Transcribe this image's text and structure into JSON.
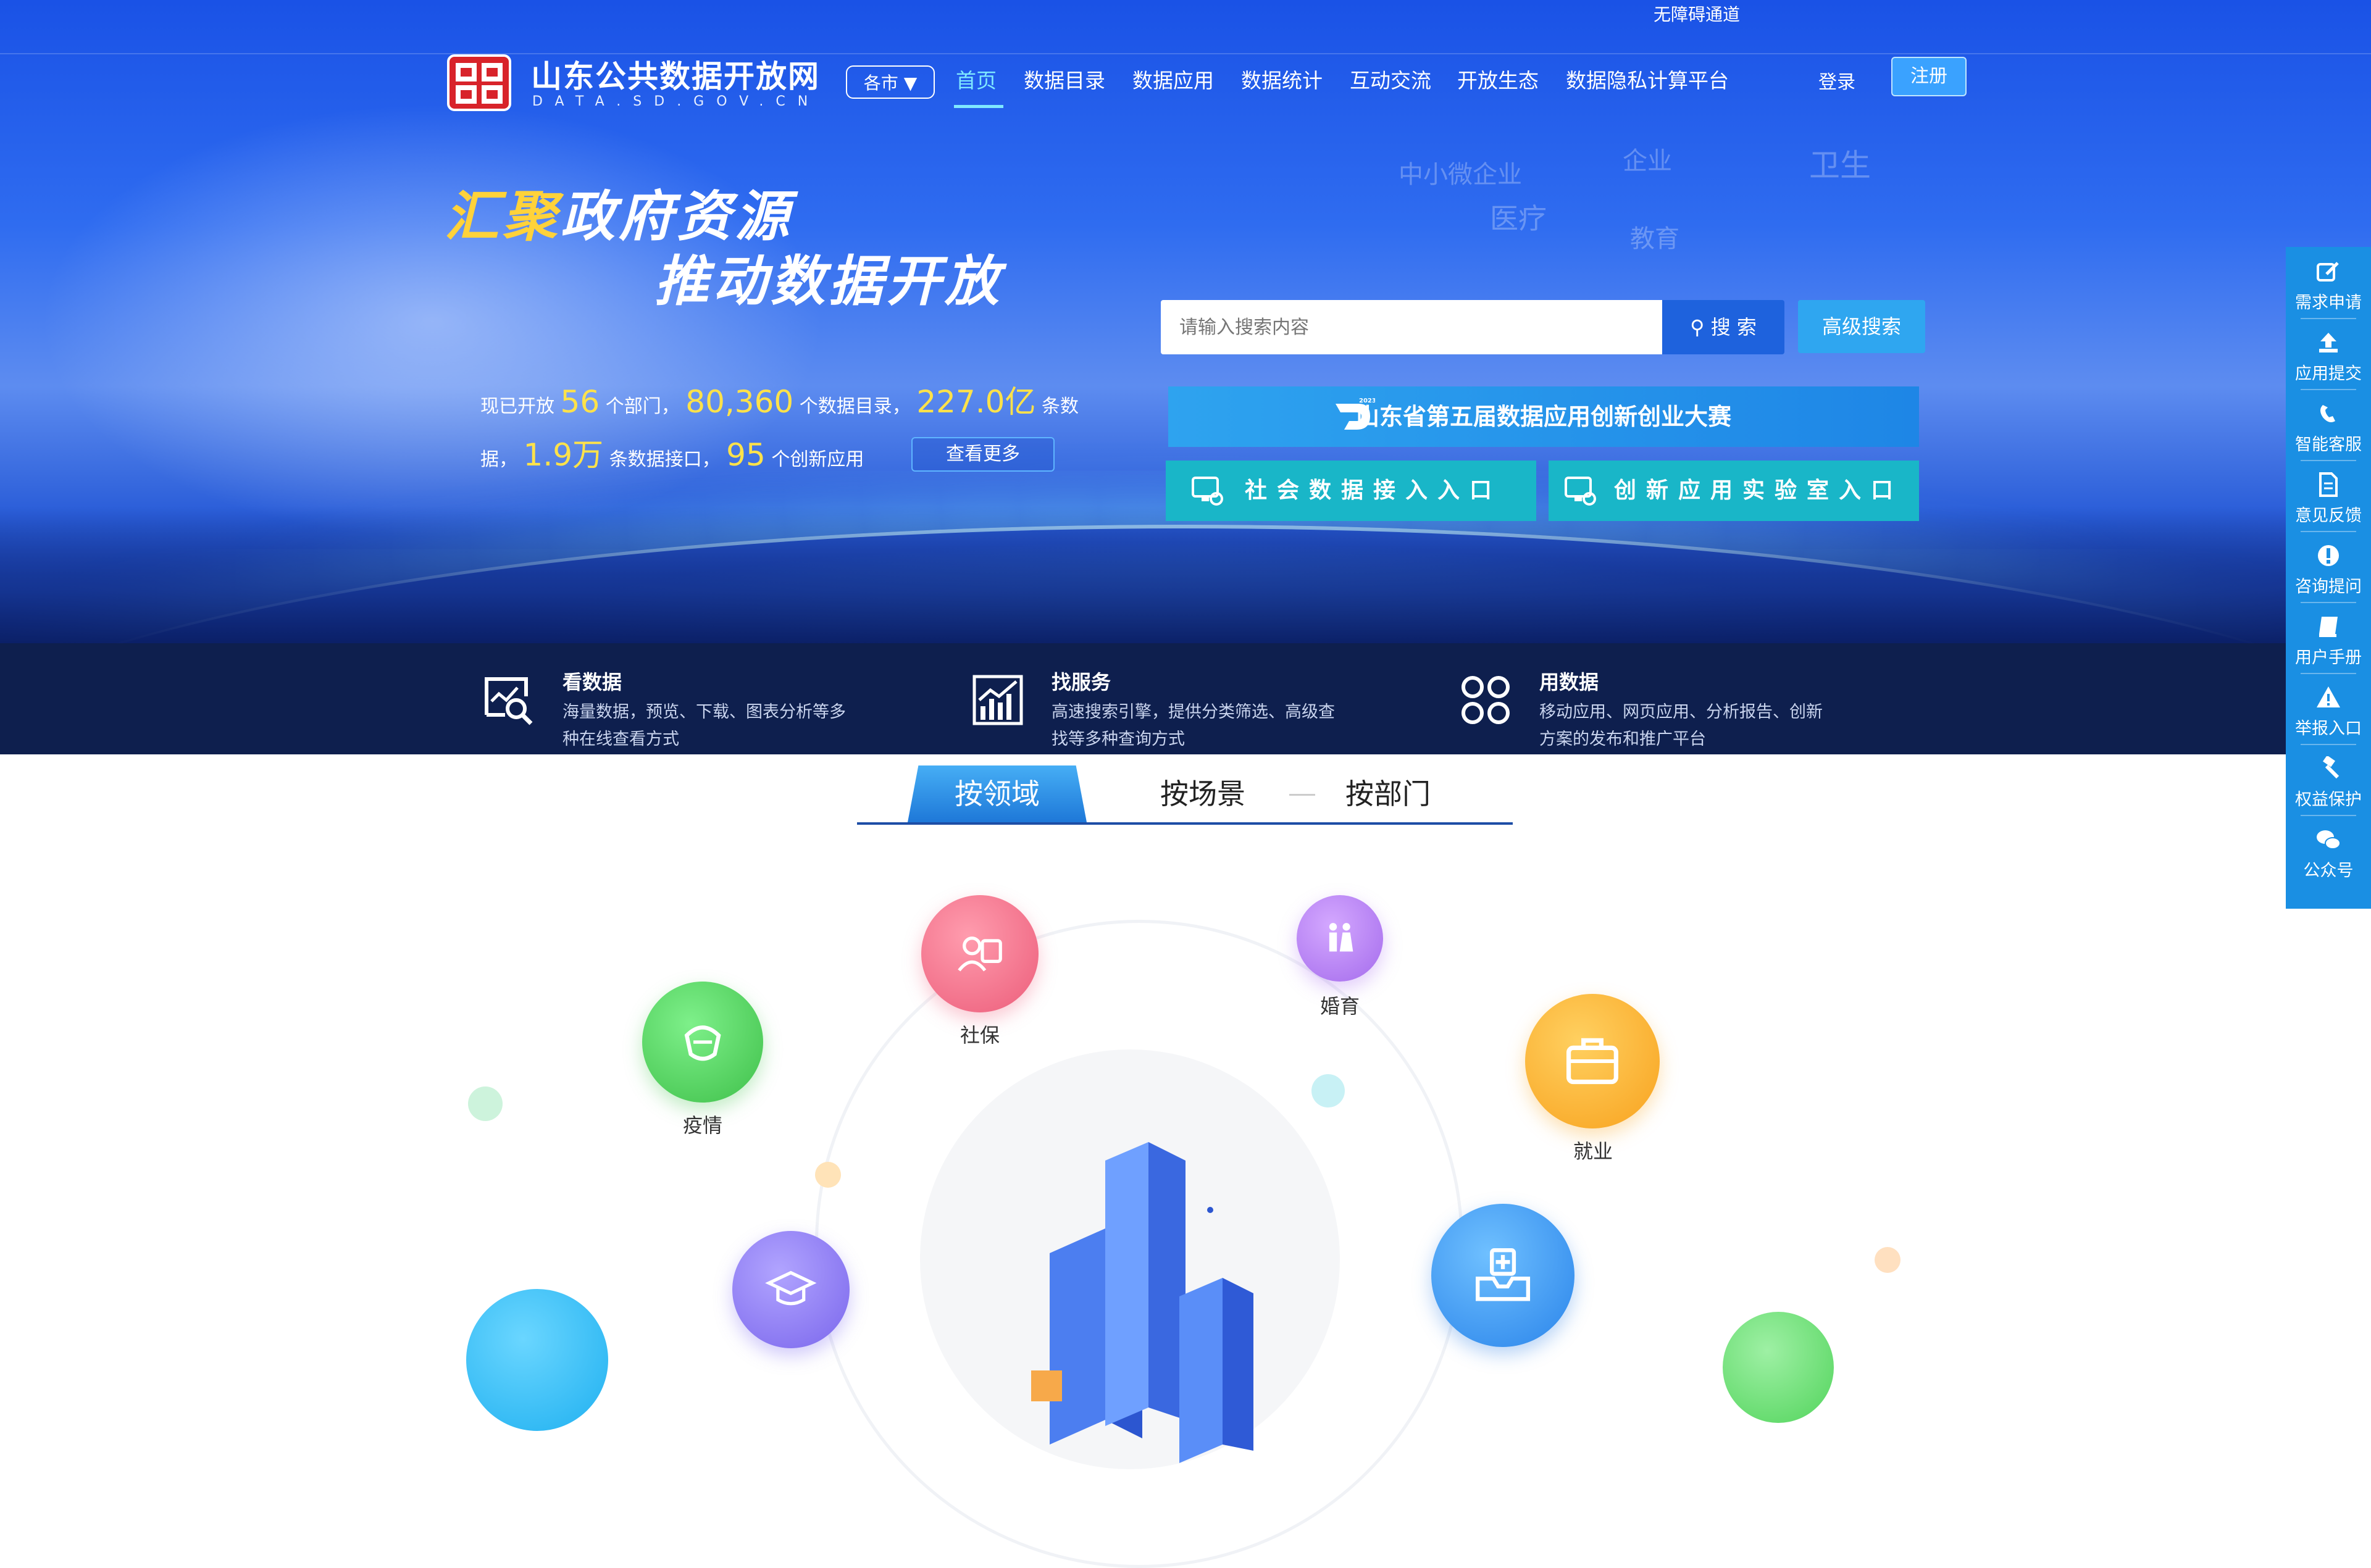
{
  "header": {
    "accessibility_link": "无障碍通道",
    "site_title": "山东公共数据开放网",
    "site_domain": "DATA.SD.GOV.CN",
    "city_select": "各市",
    "nav": [
      "首页",
      "数据目录",
      "数据应用",
      "数据统计",
      "互动交流",
      "开放生态",
      "数据隐私计算平台"
    ],
    "active_nav": "首页",
    "login": "登录",
    "register": "注册"
  },
  "hero": {
    "slogan_line1_highlight": "汇聚",
    "slogan_line1_rest": "政府资源",
    "slogan_line2": "推动数据开放",
    "map_words": [
      "中小微企业",
      "企业",
      "卫生",
      "医疗",
      "教育"
    ],
    "stats": {
      "prefix": "现已开放",
      "departments_value": "56",
      "departments_unit": "个部门，",
      "catalogs_value": "80,360",
      "catalogs_unit": "个数据目录，",
      "records_value": "227.0亿",
      "records_unit_a": "条数",
      "records_unit_b": "据，",
      "apis_value": "1.9万",
      "apis_unit": "条数据接口，",
      "apps_value": "95",
      "apps_unit": "个创新应用"
    },
    "more_button": "查看更多",
    "search": {
      "placeholder": "请输入搜索内容",
      "button": "搜 索",
      "advanced": "高级搜索"
    },
    "contest_badge_year": "2023",
    "contest_banner": "山东省第五届数据应用创新创业大赛",
    "social_data_entry": "社会数据接入入口",
    "innovation_lab_entry": "创新应用实验室入口"
  },
  "features": [
    {
      "title": "看数据",
      "desc": "海量数据，预览、下载、图表分析等多种在线查看方式",
      "icon": "magnifier-chart-icon"
    },
    {
      "title": "找服务",
      "desc": "高速搜索引擎，提供分类筛选、高级查找等多种查询方式",
      "icon": "bar-chart-icon"
    },
    {
      "title": "用数据",
      "desc": "移动应用、网页应用、分析报告、创新方案的发布和推广平台",
      "icon": "four-squares-icon"
    }
  ],
  "tabs": [
    "按领域",
    "按场景",
    "按部门"
  ],
  "active_tab": "按领域",
  "domains": [
    {
      "label": "疫情",
      "color": "#4fd05a",
      "icon": "mask-icon"
    },
    {
      "label": "社保",
      "color": "#f06c86",
      "icon": "social-security-icon"
    },
    {
      "label": "婚育",
      "color": "#b27ef0",
      "icon": "family-icon"
    },
    {
      "label": "就业",
      "color": "#fbb428",
      "icon": "briefcase-icon"
    },
    {
      "label": "",
      "color": "#8a7ef0",
      "icon": "graduation-cap-icon"
    },
    {
      "label": "",
      "color": "#3aa0f0",
      "icon": "medical-kit-icon"
    }
  ],
  "right_rail": [
    {
      "label": "需求申请",
      "icon": "edit-icon"
    },
    {
      "label": "应用提交",
      "icon": "upload-icon"
    },
    {
      "label": "智能客服",
      "icon": "phone-icon"
    },
    {
      "label": "意见反馈",
      "icon": "document-icon"
    },
    {
      "label": "咨询提问",
      "icon": "exclamation-icon"
    },
    {
      "label": "用户手册",
      "icon": "book-icon"
    },
    {
      "label": "举报入口",
      "icon": "warning-icon"
    },
    {
      "label": "权益保护",
      "icon": "gavel-icon"
    },
    {
      "label": "公众号",
      "icon": "wechat-icon"
    }
  ]
}
